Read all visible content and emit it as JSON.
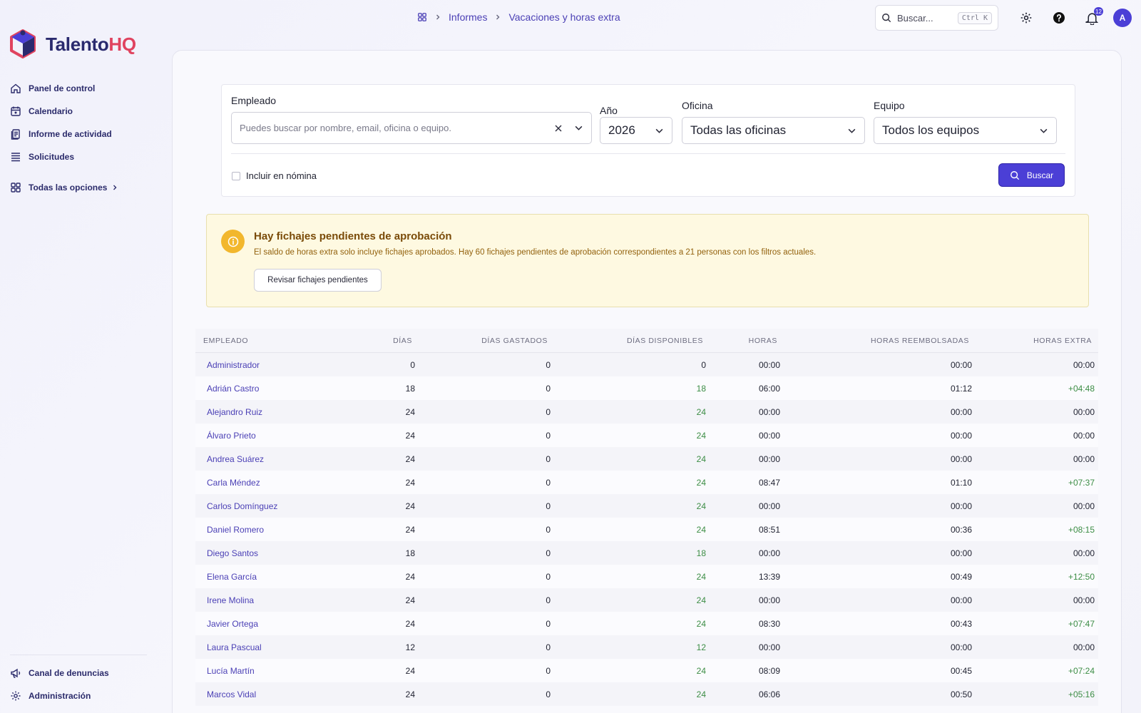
{
  "brand": {
    "name_a": "Talento",
    "name_b": "HQ",
    "primary": "#4b3fd6",
    "accent": "#e0435f"
  },
  "breadcrumb": {
    "home_icon": "grid-icon",
    "items": [
      "Informes",
      "Vacaciones y horas extra"
    ]
  },
  "topbar": {
    "search_placeholder": "Buscar...",
    "search_shortcut": "Ctrl K",
    "notifications_count": "12",
    "avatar_initial": "A"
  },
  "sidebar": {
    "items": [
      {
        "label": "Panel de control",
        "icon": "home-icon"
      },
      {
        "label": "Calendario",
        "icon": "calendar-icon"
      },
      {
        "label": "Informe de actividad",
        "icon": "report-icon"
      },
      {
        "label": "Solicitudes",
        "icon": "list-icon"
      }
    ],
    "all_options": "Todas las opciones",
    "bottom": [
      {
        "label": "Canal de denuncias",
        "icon": "megaphone-icon"
      },
      {
        "label": "Administración",
        "icon": "gear-icon"
      }
    ]
  },
  "filters": {
    "employee_label": "Empleado",
    "employee_placeholder": "Puedes buscar por nombre, email, oficina o equipo.",
    "year_label": "Año",
    "year_value": "2026",
    "office_label": "Oficina",
    "office_value": "Todas las oficinas",
    "team_label": "Equipo",
    "team_value": "Todos los equipos",
    "include_payroll": "Incluir en nómina",
    "search_button": "Buscar"
  },
  "alert": {
    "title": "Hay fichajes pendientes de aprobación",
    "text": "El saldo de horas extra solo incluye fichajes aprobados. Hay 60 fichajes pendientes de aprobación correspondientes a 21 personas con los filtros actuales.",
    "button": "Revisar fichajes pendientes"
  },
  "table": {
    "headers": [
      "EMPLEADO",
      "DÍAS",
      "DÍAS GASTADOS",
      "DÍAS DISPONIBLES",
      "HORAS",
      "HORAS REEMBOLSADAS",
      "HORAS EXTRA"
    ],
    "rows": [
      {
        "name": "Administrador",
        "dias": "0",
        "gastados": "0",
        "disponibles": "0",
        "horas": "00:00",
        "reembolsadas": "00:00",
        "extra": "00:00"
      },
      {
        "name": "Adrián Castro",
        "dias": "18",
        "gastados": "0",
        "disponibles": "18",
        "horas": "06:00",
        "reembolsadas": "01:12",
        "extra": "+04:48"
      },
      {
        "name": "Alejandro Ruiz",
        "dias": "24",
        "gastados": "0",
        "disponibles": "24",
        "horas": "00:00",
        "reembolsadas": "00:00",
        "extra": "00:00"
      },
      {
        "name": "Álvaro Prieto",
        "dias": "24",
        "gastados": "0",
        "disponibles": "24",
        "horas": "00:00",
        "reembolsadas": "00:00",
        "extra": "00:00"
      },
      {
        "name": "Andrea Suárez",
        "dias": "24",
        "gastados": "0",
        "disponibles": "24",
        "horas": "00:00",
        "reembolsadas": "00:00",
        "extra": "00:00"
      },
      {
        "name": "Carla Méndez",
        "dias": "24",
        "gastados": "0",
        "disponibles": "24",
        "horas": "08:47",
        "reembolsadas": "01:10",
        "extra": "+07:37"
      },
      {
        "name": "Carlos Domínguez",
        "dias": "24",
        "gastados": "0",
        "disponibles": "24",
        "horas": "00:00",
        "reembolsadas": "00:00",
        "extra": "00:00"
      },
      {
        "name": "Daniel Romero",
        "dias": "24",
        "gastados": "0",
        "disponibles": "24",
        "horas": "08:51",
        "reembolsadas": "00:36",
        "extra": "+08:15"
      },
      {
        "name": "Diego Santos",
        "dias": "18",
        "gastados": "0",
        "disponibles": "18",
        "horas": "00:00",
        "reembolsadas": "00:00",
        "extra": "00:00"
      },
      {
        "name": "Elena García",
        "dias": "24",
        "gastados": "0",
        "disponibles": "24",
        "horas": "13:39",
        "reembolsadas": "00:49",
        "extra": "+12:50"
      },
      {
        "name": "Irene Molina",
        "dias": "24",
        "gastados": "0",
        "disponibles": "24",
        "horas": "00:00",
        "reembolsadas": "00:00",
        "extra": "00:00"
      },
      {
        "name": "Javier Ortega",
        "dias": "24",
        "gastados": "0",
        "disponibles": "24",
        "horas": "08:30",
        "reembolsadas": "00:43",
        "extra": "+07:47"
      },
      {
        "name": "Laura Pascual",
        "dias": "12",
        "gastados": "0",
        "disponibles": "12",
        "horas": "00:00",
        "reembolsadas": "00:00",
        "extra": "00:00"
      },
      {
        "name": "Lucía Martín",
        "dias": "24",
        "gastados": "0",
        "disponibles": "24",
        "horas": "08:09",
        "reembolsadas": "00:45",
        "extra": "+07:24"
      },
      {
        "name": "Marcos Vidal",
        "dias": "24",
        "gastados": "0",
        "disponibles": "24",
        "horas": "06:06",
        "reembolsadas": "00:50",
        "extra": "+05:16"
      }
    ]
  }
}
